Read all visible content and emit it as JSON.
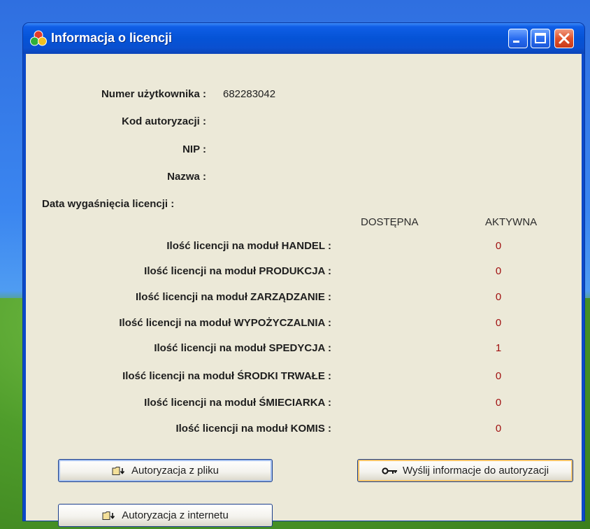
{
  "window": {
    "title": "Informacja o licencji"
  },
  "fields": [
    {
      "label": "Numer użytkownika :",
      "value": "682283042"
    },
    {
      "label": "Kod autoryzacji :",
      "value": ""
    },
    {
      "label": "NIP :",
      "value": ""
    },
    {
      "label": "Nazwa :",
      "value": ""
    },
    {
      "label": "Data wygaśnięcia licencji :",
      "value": ""
    }
  ],
  "columns": {
    "available": "DOSTĘPNA",
    "active": "AKTYWNA"
  },
  "modules": [
    {
      "label": "Ilość licencji na moduł HANDEL :",
      "available": "",
      "active": "0"
    },
    {
      "label": "Ilość licencji na moduł PRODUKCJA :",
      "available": "",
      "active": "0"
    },
    {
      "label": "Ilość licencji na moduł ZARZĄDZANIE :",
      "available": "",
      "active": "0"
    },
    {
      "label": "Ilość licencji na moduł WYPOŻYCZALNIA :",
      "available": "",
      "active": "0"
    },
    {
      "label": "Ilość licencji na moduł SPEDYCJA :",
      "available": "",
      "active": "1"
    },
    {
      "label": "Ilość licencji na moduł ŚRODKI TRWAŁE :",
      "available": "",
      "active": "0"
    },
    {
      "label": "Ilość licencji na moduł ŚMIECIARKA :",
      "available": "",
      "active": "0"
    },
    {
      "label": "Ilość licencji na moduł KOMIS :",
      "available": "",
      "active": "0"
    }
  ],
  "buttons": {
    "auth_file": "Autoryzacja z pliku",
    "auth_internet": "Autoryzacja z internetu",
    "send_info": "Wyślij informacje do autoryzacji"
  },
  "icons": {
    "app": "colored-circles-icon",
    "folder": "folder-arrow-icon",
    "key": "key-icon"
  }
}
